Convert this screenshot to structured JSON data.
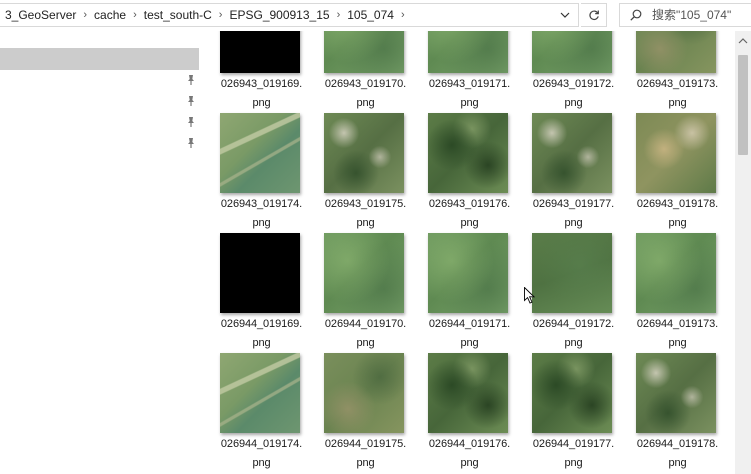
{
  "address_bar": {
    "crumbs": [
      "3_GeoServer",
      "cache",
      "test_south-C",
      "EPSG_900913_15",
      "105_074"
    ]
  },
  "search": {
    "placeholder": "搜索\"105_074\""
  },
  "nav_pane": {
    "pinned_count": 4
  },
  "files": {
    "rows": [
      [
        {
          "name": "026943_019169.",
          "ext": "png",
          "style": "black"
        },
        {
          "name": "026943_019170.",
          "ext": "png",
          "style": "green"
        },
        {
          "name": "026943_019171.",
          "ext": "png",
          "style": "green"
        },
        {
          "name": "026943_019172.",
          "ext": "png",
          "style": "green"
        },
        {
          "name": "026943_019173.",
          "ext": "png",
          "style": "mixed"
        }
      ],
      [
        {
          "name": "026943_019174.",
          "ext": "png",
          "style": "river"
        },
        {
          "name": "026943_019175.",
          "ext": "png",
          "style": "village"
        },
        {
          "name": "026943_019176.",
          "ext": "png",
          "style": "hills"
        },
        {
          "name": "026943_019177.",
          "ext": "png",
          "style": "village"
        },
        {
          "name": "026943_019178.",
          "ext": "png",
          "style": "town"
        }
      ],
      [
        {
          "name": "026944_019169.",
          "ext": "png",
          "style": "black"
        },
        {
          "name": "026944_019170.",
          "ext": "png",
          "style": "green"
        },
        {
          "name": "026944_019171.",
          "ext": "png",
          "style": "green"
        },
        {
          "name": "026944_019172.",
          "ext": "png",
          "style": "darkgreen"
        },
        {
          "name": "026944_019173.",
          "ext": "png",
          "style": "green"
        }
      ],
      [
        {
          "name": "026944_019174.",
          "ext": "png",
          "style": "river"
        },
        {
          "name": "026944_019175.",
          "ext": "png",
          "style": "mixed"
        },
        {
          "name": "026944_019176.",
          "ext": "png",
          "style": "hills"
        },
        {
          "name": "026944_019177.",
          "ext": "png",
          "style": "hills"
        },
        {
          "name": "026944_019178.",
          "ext": "png",
          "style": "village"
        }
      ]
    ]
  },
  "colors": {
    "selection": "#cccccc",
    "border": "#d9d9d9",
    "scroll_track": "#f0f0f0",
    "scroll_thumb": "#c1c1c1"
  }
}
